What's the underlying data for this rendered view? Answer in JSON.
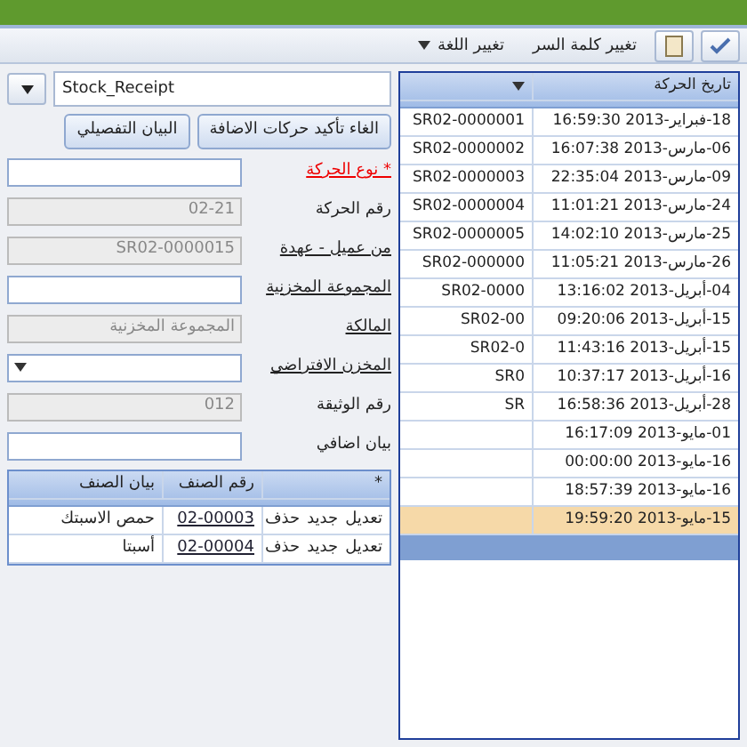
{
  "menu": [
    {
      "label": "تغيير كلمة السر",
      "has_caret": false
    },
    {
      "label": "تغيير اللغة",
      "has_caret": true
    }
  ],
  "form_title": "Stock_Receipt",
  "buttons": [
    "الغاء تأكيد حركات الاضافة",
    "البيان التفصيلي"
  ],
  "fields": [
    {
      "label": "* نوع الحركة",
      "required": true,
      "linked": true,
      "kind": "text"
    },
    {
      "label": "رقم الحركة",
      "required": false,
      "linked": false,
      "kind": "readonly",
      "value": "02-21"
    },
    {
      "label": "من عميل - عهدة",
      "required": false,
      "linked": true,
      "kind": "readonly",
      "value": "SR02-0000015"
    },
    {
      "label": "المجموعة المخزنية",
      "required": false,
      "linked": true,
      "kind": "text"
    },
    {
      "label": "المالكة",
      "required": false,
      "linked": true,
      "kind": "readonly",
      "value": "المجموعة المخزنية"
    },
    {
      "label": "المخزن الافتراضي",
      "required": false,
      "linked": true,
      "kind": "select"
    },
    {
      "label": "رقم الوثيقة",
      "required": false,
      "linked": false,
      "kind": "readonly",
      "value": "012"
    },
    {
      "label": "بيان اضافي",
      "required": false,
      "linked": false,
      "kind": "text"
    }
  ],
  "items_grid": {
    "new_row_marker": "*",
    "columns": [
      "رقم الصنف",
      "بيان الصنف"
    ],
    "rows": [
      {
        "actions": [
          "تعديل",
          "جديد",
          "حذف"
        ],
        "item_no": "02-00003",
        "description": "حمص الاسبتك"
      },
      {
        "actions": [
          "تعديل",
          "جديد",
          "حذف"
        ],
        "item_no": "02-00004",
        "description": "أسبتا"
      }
    ]
  },
  "transactions_grid": {
    "columns": [
      "تاريخ الحركة"
    ],
    "rows": [
      {
        "date": "18-فبراير-2013 16:59:30",
        "id": "SR02-0000001",
        "selected": false
      },
      {
        "date": "06-مارس-2013 16:07:38",
        "id": "SR02-0000002",
        "selected": false
      },
      {
        "date": "09-مارس-2013 22:35:04",
        "id": "SR02-0000003",
        "selected": false
      },
      {
        "date": "24-مارس-2013 11:01:21",
        "id": "SR02-0000004",
        "selected": false
      },
      {
        "date": "25-مارس-2013 14:02:10",
        "id": "SR02-0000005",
        "selected": false
      },
      {
        "date": "26-مارس-2013 11:05:21",
        "id": "SR02-000000",
        "selected": false
      },
      {
        "date": "04-أبريل-2013 13:16:02",
        "id": "SR02-0000",
        "selected": false
      },
      {
        "date": "15-أبريل-2013 09:20:06",
        "id": "SR02-00",
        "selected": false
      },
      {
        "date": "15-أبريل-2013 11:43:16",
        "id": "SR02-0",
        "selected": false
      },
      {
        "date": "16-أبريل-2013 10:37:17",
        "id": "SR0",
        "selected": false
      },
      {
        "date": "28-أبريل-2013 16:58:36",
        "id": "SR",
        "selected": false
      },
      {
        "date": "01-مايو-2013 16:17:09",
        "selected": false
      },
      {
        "date": "16-مايو-2013 00:00:00",
        "selected": false
      },
      {
        "date": "16-مايو-2013 18:57:39",
        "selected": false
      },
      {
        "date": "15-مايو-2013 19:59:20",
        "selected": true
      }
    ]
  }
}
